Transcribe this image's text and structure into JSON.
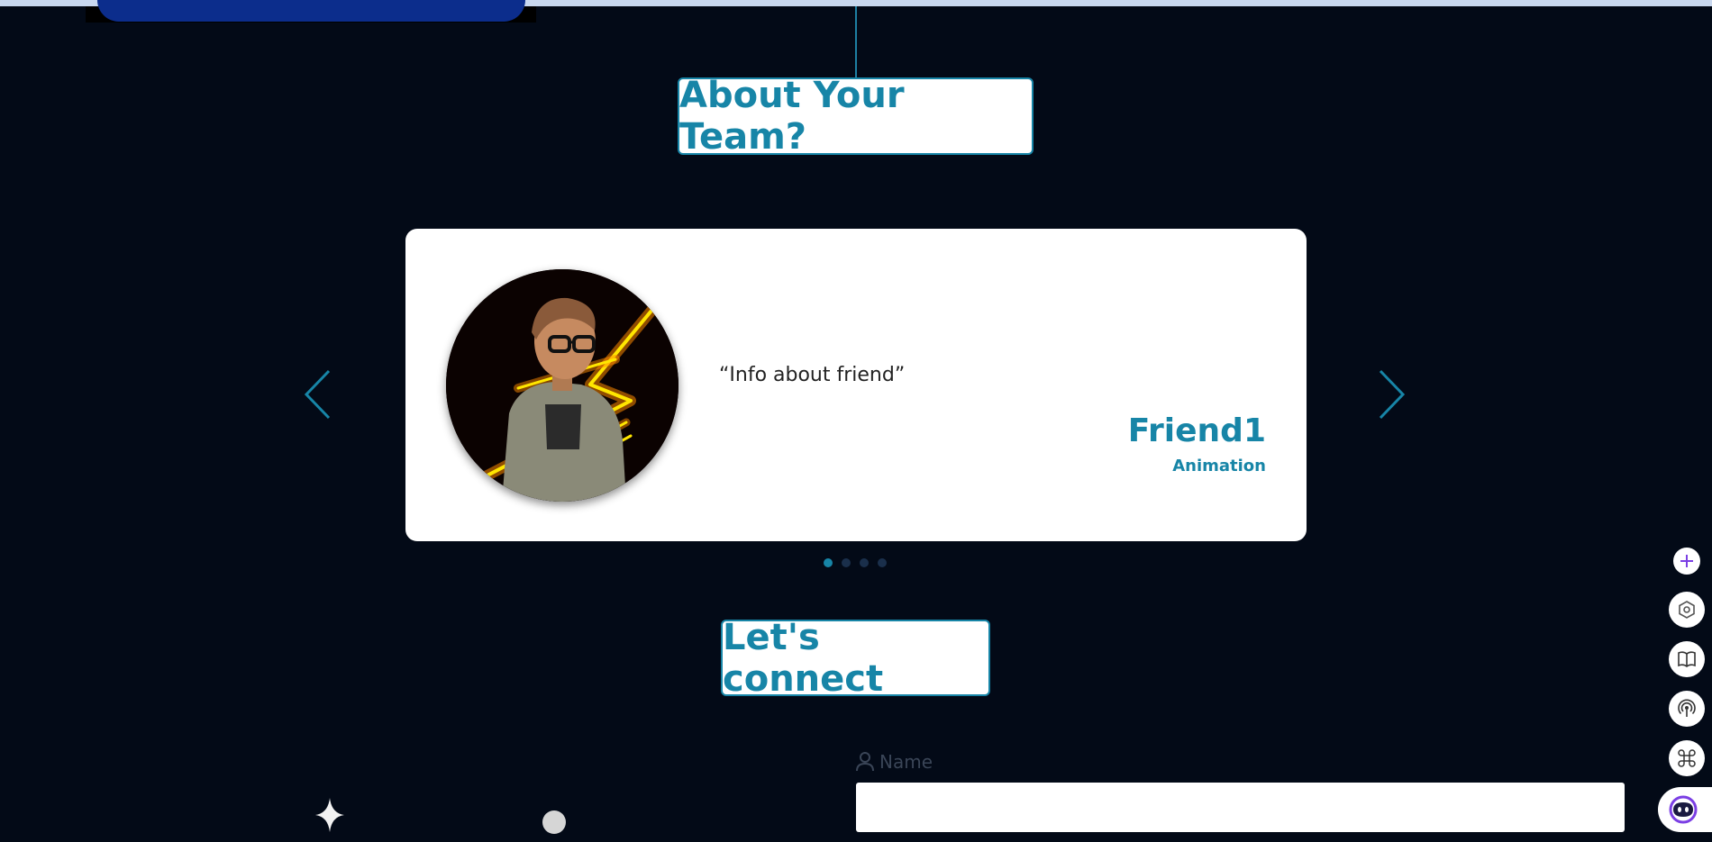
{
  "sections": {
    "about": {
      "heading": "About Your Team?"
    },
    "connect": {
      "heading": "Let's connect"
    }
  },
  "testimonial": {
    "quote": "“Info about friend”",
    "name": "Friend1",
    "role": "Animation",
    "avatar_icon": "neon-lightning-portrait",
    "slide_count": 4,
    "active_slide": 1
  },
  "carousel": {
    "prev_icon": "chevron-left-icon",
    "next_icon": "chevron-right-icon"
  },
  "form": {
    "name_label": "Name",
    "name_value": ""
  },
  "sidebar_icons": [
    "plus-icon",
    "settings-hex-icon",
    "book-icon",
    "broadcast-icon",
    "command-icon",
    "assistant-face-icon"
  ],
  "colors": {
    "background": "#030a17",
    "accent": "#1785a7",
    "card": "#ffffff",
    "dot_inactive": "#1a2f4b",
    "sidebar_accent": "#7b3fe4"
  }
}
